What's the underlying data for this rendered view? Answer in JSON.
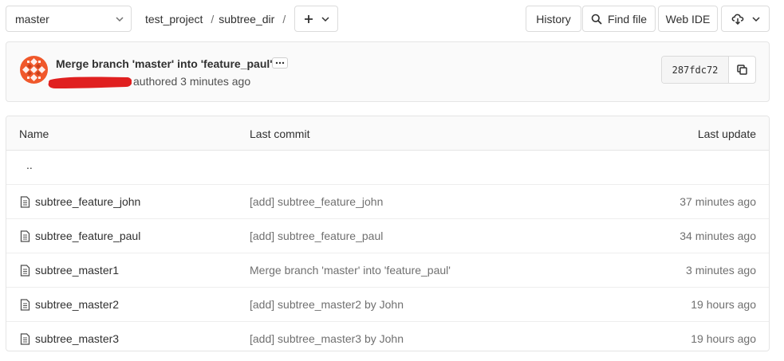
{
  "toolbar": {
    "branch": "master",
    "breadcrumbs": [
      "test_project",
      "subtree_dir"
    ],
    "separator": "/",
    "add_symbol": "+",
    "history_label": "History",
    "find_file_label": "Find file",
    "web_ide_label": "Web IDE",
    "icons": {
      "add": "plus-icon",
      "dropdown": "chevron-down-icon",
      "find": "search-icon",
      "download": "cloud-download-icon"
    }
  },
  "commit": {
    "title": "Merge branch 'master' into 'feature_paul'",
    "authored": "authored 3 minutes ago",
    "sha": "287fdc72",
    "icons": {
      "more": "ellipsis-icon",
      "copy": "copy-icon"
    },
    "redaction_color": "#e02020"
  },
  "tree": {
    "headers": {
      "name": "Name",
      "last_commit": "Last commit",
      "last_update": "Last update"
    },
    "parent_dir": "..",
    "rows": [
      {
        "name": "subtree_feature_john",
        "commit": "[add] subtree_feature_john",
        "updated": "37 minutes ago"
      },
      {
        "name": "subtree_feature_paul",
        "commit": "[add] subtree_feature_paul",
        "updated": "34 minutes ago"
      },
      {
        "name": "subtree_master1",
        "commit": "Merge branch 'master' into 'feature_paul'",
        "updated": "3 minutes ago"
      },
      {
        "name": "subtree_master2",
        "commit": "[add] subtree_master2 by John",
        "updated": "19 hours ago"
      },
      {
        "name": "subtree_master3",
        "commit": "[add] subtree_master3 by John",
        "updated": "19 hours ago"
      }
    ],
    "file_icon": "file-icon"
  }
}
